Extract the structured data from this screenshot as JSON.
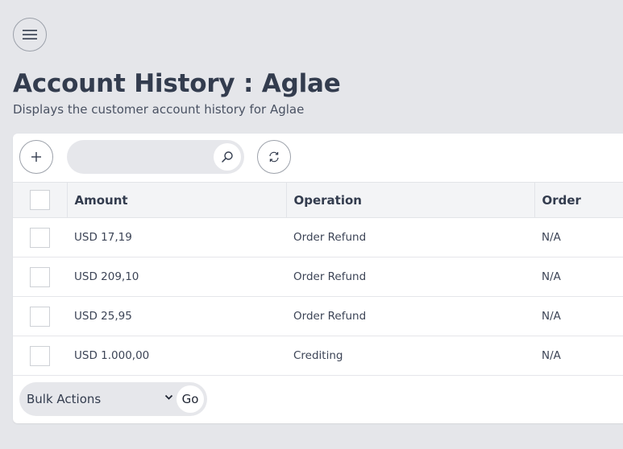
{
  "header": {
    "menu_icon": "hamburger-icon",
    "title": "Account History : Aglae",
    "subtitle": "Displays the customer account history for Aglae"
  },
  "toolbar": {
    "add_icon": "plus-icon",
    "search_placeholder": "",
    "search_icon": "search-icon",
    "refresh_icon": "refresh-icon"
  },
  "table": {
    "columns": [
      "Amount",
      "Operation",
      "Order"
    ],
    "rows": [
      {
        "amount": "USD 17,19",
        "operation": "Order Refund",
        "order": "N/A"
      },
      {
        "amount": "USD 209,10",
        "operation": "Order Refund",
        "order": "N/A"
      },
      {
        "amount": "USD 25,95",
        "operation": "Order Refund",
        "order": "N/A"
      },
      {
        "amount": "USD 1.000,00",
        "operation": "Crediting",
        "order": "N/A"
      }
    ]
  },
  "footer": {
    "bulk_actions_label": "Bulk Actions",
    "go_label": "Go"
  },
  "colors": {
    "background": "#e5e6ea",
    "card": "#ffffff",
    "text": "#333c4e",
    "header_row": "#f3f4f6"
  }
}
